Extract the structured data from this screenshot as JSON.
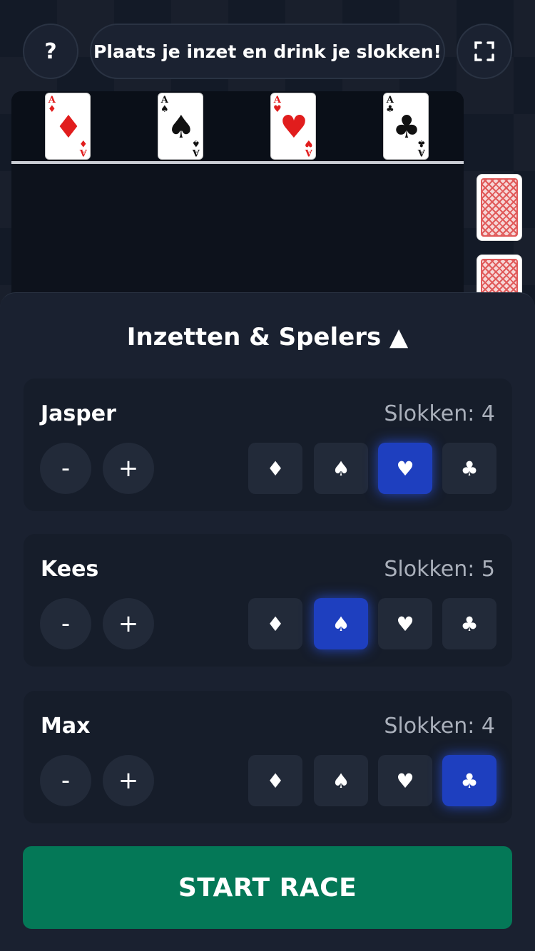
{
  "header": {
    "help_label": "?",
    "message": "Plaats je inzet en drink je slokken!",
    "fullscreen_icon": "fullscreen-icon"
  },
  "track": {
    "aces": [
      {
        "rank": "A",
        "suit": "♦",
        "color": "#e11d1d"
      },
      {
        "rank": "A",
        "suit": "♠",
        "color": "#111111"
      },
      {
        "rank": "A",
        "suit": "♥",
        "color": "#e11d1d"
      },
      {
        "rank": "A",
        "suit": "♣",
        "color": "#111111"
      }
    ]
  },
  "panel": {
    "title": "Inzetten & Spelers ▲",
    "suits": [
      "♦",
      "♠",
      "♥",
      "♣"
    ],
    "minus_label": "-",
    "plus_label": "+",
    "players": [
      {
        "name": "Jasper",
        "sips": "Slokken: 4",
        "selected_suit": "♥"
      },
      {
        "name": "Kees",
        "sips": "Slokken: 5",
        "selected_suit": "♠"
      },
      {
        "name": "Max",
        "sips": "Slokken: 4",
        "selected_suit": "♣"
      }
    ]
  },
  "actions": {
    "start_label": "START RACE"
  },
  "colors": {
    "accent_selected": "#1e3fbf",
    "start_button": "#047857",
    "background": "#131a27"
  }
}
